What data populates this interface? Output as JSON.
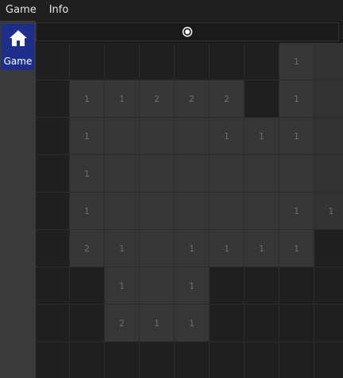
{
  "menu": {
    "game": "Game",
    "info": "Info"
  },
  "sidebar": {
    "items": [
      {
        "label": "Game",
        "icon": "home-icon",
        "selected": true
      }
    ]
  },
  "status": {
    "icon": "radio-icon"
  },
  "board": {
    "rows": 9,
    "cols": 9,
    "cells": [
      [
        "H",
        "H",
        "H",
        "H",
        "H",
        "H",
        "H",
        "1",
        "O"
      ],
      [
        "H",
        "1",
        "1",
        "2",
        "2",
        "2",
        "H",
        "1",
        "O"
      ],
      [
        "H",
        "1",
        "O",
        "O",
        "O",
        "1",
        "1",
        "1",
        "O"
      ],
      [
        "H",
        "1",
        "O",
        "O",
        "O",
        "O",
        "O",
        "O",
        "O"
      ],
      [
        "H",
        "1",
        "O",
        "O",
        "O",
        "O",
        "O",
        "1",
        "1"
      ],
      [
        "H",
        "2",
        "1",
        "O",
        "1",
        "1",
        "1",
        "1",
        "H"
      ],
      [
        "H",
        "H",
        "1",
        "O",
        "1",
        "H",
        "H",
        "H",
        "H"
      ],
      [
        "H",
        "H",
        "2",
        "1",
        "1",
        "H",
        "H",
        "H",
        "H"
      ],
      [
        "H",
        "H",
        "H",
        "H",
        "H",
        "H",
        "H",
        "H",
        "H"
      ]
    ]
  },
  "colors": {
    "accent": "#1f2e8a",
    "hidden_cell": "#1f1f1f",
    "open_cell": "#363636",
    "number_text": "#6e6e6e"
  }
}
